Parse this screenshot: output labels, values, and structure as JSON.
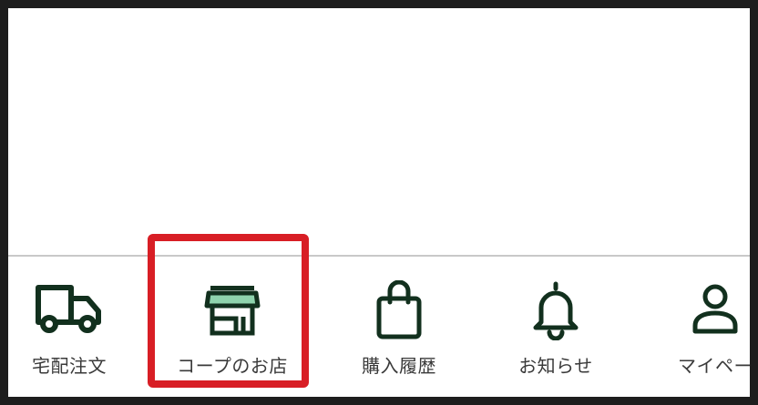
{
  "tabbar": {
    "items": [
      {
        "label": "宅配注文",
        "icon": "truck-icon"
      },
      {
        "label": "コープのお店",
        "icon": "store-icon"
      },
      {
        "label": "購入履歴",
        "icon": "shopping-bag-icon"
      },
      {
        "label": "お知らせ",
        "icon": "bell-icon"
      },
      {
        "label": "マイペー",
        "icon": "user-icon"
      }
    ]
  },
  "colors": {
    "icon_stroke": "#12301e",
    "store_awning": "#8fd3ad",
    "highlight": "#d81e25",
    "label": "#3a3a3a",
    "frame": "#1d1d1d"
  }
}
